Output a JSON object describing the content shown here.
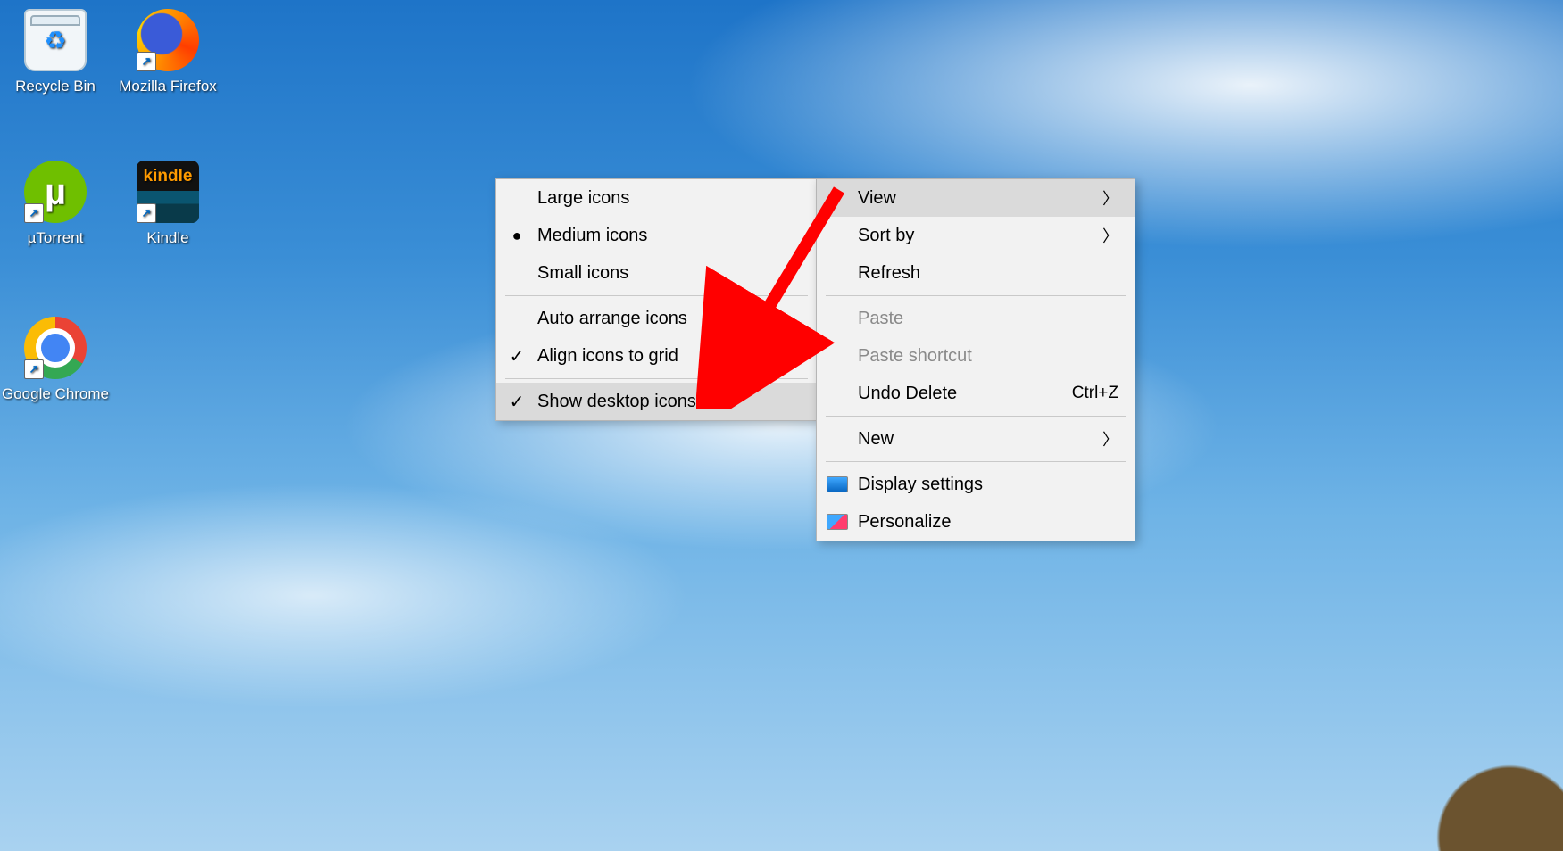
{
  "desktop_icons": {
    "recycle_bin": "Recycle Bin",
    "firefox": "Mozilla Firefox",
    "utorrent_symbol": "µ",
    "utorrent": "µTorrent",
    "kindle_logo": "kindle",
    "kindle": "Kindle",
    "chrome": "Google Chrome"
  },
  "context_menu": {
    "view": "View",
    "sort_by": "Sort by",
    "refresh": "Refresh",
    "paste": "Paste",
    "paste_shortcut": "Paste shortcut",
    "undo_delete": "Undo Delete",
    "undo_delete_key": "Ctrl+Z",
    "new": "New",
    "display_settings": "Display settings",
    "personalize": "Personalize"
  },
  "view_submenu": {
    "large_icons": "Large icons",
    "medium_icons": "Medium icons",
    "small_icons": "Small icons",
    "auto_arrange": "Auto arrange icons",
    "align_grid": "Align icons to grid",
    "show_desktop_icons": "Show desktop icons"
  },
  "annotation": {
    "purpose": "Red arrow pointing to 'Show desktop icons' option"
  }
}
